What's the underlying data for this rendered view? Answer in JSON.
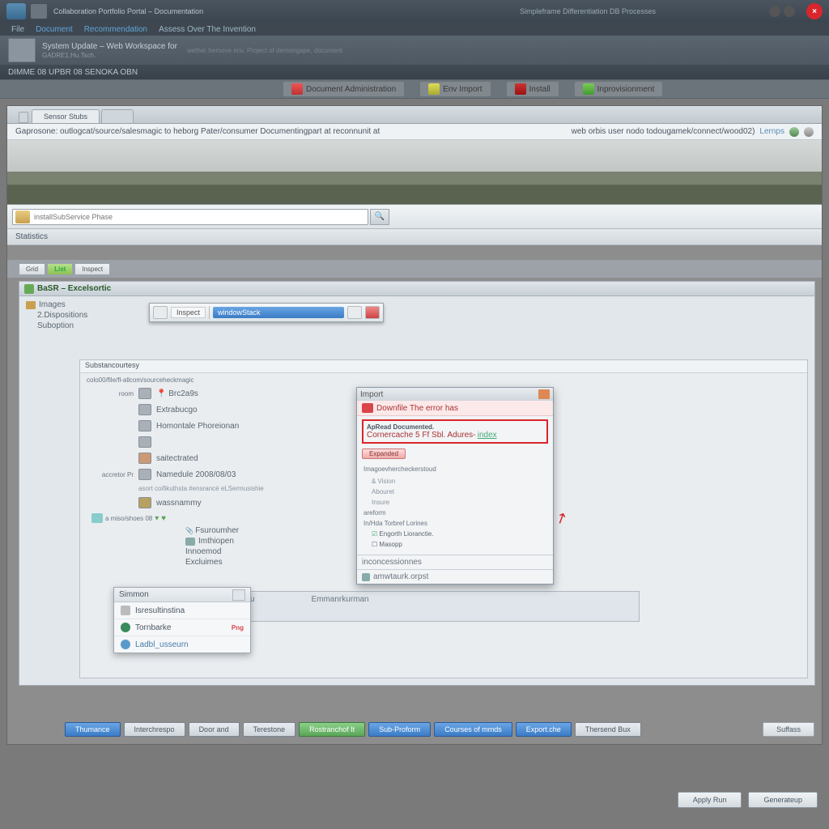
{
  "titlebar": {
    "title": "Collaboration Portfolio Portal – Documentation",
    "subtitle": "Simpleframe Differentiation DB Processes"
  },
  "menubar": {
    "items": [
      "File",
      "Document",
      "Recommendation",
      "Assess Over The Invention"
    ]
  },
  "header": {
    "title": "System Update – Web Workspace for",
    "subtitle": "GADRE1.Hu.Tsch.",
    "note": "wether Iremove env. Project of demongape, document"
  },
  "secbar": {
    "text": "DIMME 08  UPBR 08  SENOKA OBN"
  },
  "quicknav": {
    "items": [
      {
        "label": "Document Administration"
      },
      {
        "label": "Env Import"
      },
      {
        "label": "Install"
      },
      {
        "label": "Inprovisionment"
      }
    ]
  },
  "tabs": {
    "active": "Sensor Stubs"
  },
  "descbar": {
    "left": "Gaprosone: outlogcat/source/salesmagic to heborg Pater/consumer Documentingpart at reconnunit at",
    "right_text": "web orbis user nodo todougamek/connect/wood02)",
    "right_link": "Lernps"
  },
  "search": {
    "placeholder": "installSubService Phase"
  },
  "status": {
    "text": "Statistics"
  },
  "viewtog": {
    "grid": "Grid",
    "list": "List",
    "inspect": "Inspect"
  },
  "explorer": {
    "header": "BaSR – Excelsortic",
    "nodes": [
      "Images",
      "2.Dispositions",
      "Suboption"
    ]
  },
  "float_toolbar": {
    "label": "Inspect",
    "select": "windowStack"
  },
  "subcontent": {
    "header": "Substancourtesy",
    "section_label": "colo00/file/fl-allcom/sourceheckmagic",
    "rows": [
      {
        "label": "room",
        "value": "Brc2a9s"
      },
      {
        "label": "",
        "value": "Extrabucgo"
      },
      {
        "label": "",
        "value": "Homontale Phoreionan"
      },
      {
        "label": "",
        "value": ""
      },
      {
        "label": "",
        "value": "saitectrated"
      },
      {
        "label": "accretor Pr",
        "value": "Namedule 2008/08/03"
      },
      {
        "label": "",
        "value": "asort coifikuthsta #ensrancé eLSermusishie"
      },
      {
        "label": "",
        "value": "wassnammy"
      }
    ],
    "detail_group": "Fsuroumher",
    "details": [
      "Imthiopen",
      "Innoemod",
      "Excluimes"
    ],
    "hist_row": "a miso/shoes 08",
    "cat_left": "Menu",
    "cat_right": "Emmanrkurman"
  },
  "error_dialog": {
    "title": "Import",
    "warn_text": "Downfile The error has",
    "box_line1": "ApRead Documented.",
    "box_line2a": "Cornercache 5  Ff  Sbl.  Adures-",
    "box_line2b": "index",
    "button": "Expanded",
    "list_header": "Imagoevhercheckerstoud",
    "items": [
      "& Vision",
      "Abouret",
      "Insure"
    ],
    "group": "areform",
    "group2": "In/Hda Torbref Lorines",
    "check1": "Engorth Lioranctie.",
    "check2": "Masopp",
    "foot_label": "inconcessionnes",
    "foot_label2": "amwtaurk.orpst"
  },
  "dd_popup": {
    "header": "Simmon",
    "items": [
      {
        "label": "Isresultinstina",
        "count": ""
      },
      {
        "label": "Tornbarke",
        "count": "Png"
      },
      {
        "label": "Ladbl_usseurn",
        "count": ""
      }
    ]
  },
  "bottom_tabs": {
    "items": [
      "Thumance",
      "Interchrespo",
      "Door and",
      "Terestone",
      "Rostranchof It",
      "Sub-Proform",
      "Courses of mmds",
      "Export.che",
      "Thersend Bux"
    ]
  },
  "buttons": {
    "summary": "Suffass",
    "apply": "Apply Run",
    "cancel": "Generateup"
  }
}
